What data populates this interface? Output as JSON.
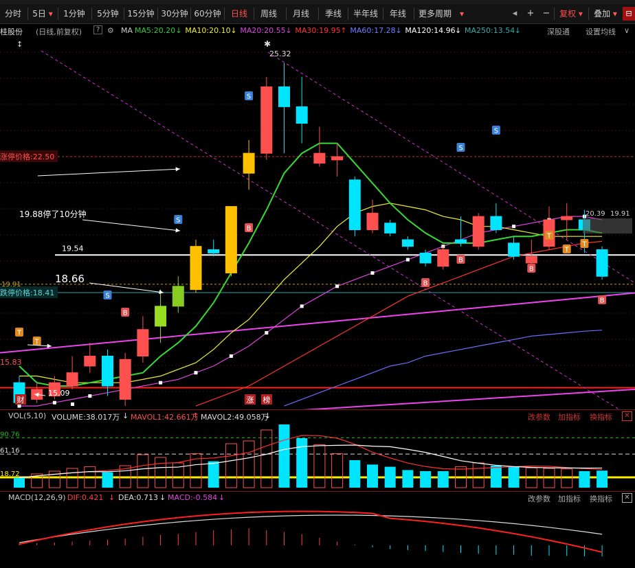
{
  "toolbar": {
    "periods": [
      "分时",
      "5日",
      "1分钟",
      "5分钟",
      "15分钟",
      "30分钟",
      "60分钟",
      "日线",
      "周线",
      "月线",
      "季线",
      "半年线",
      "年线",
      "更多周期"
    ],
    "selected": "日线",
    "right_buttons": {
      "plus": "+",
      "minus": "−",
      "fuquan": "复权",
      "overlay": "叠加"
    },
    "more_arrow": "▾"
  },
  "stock": {
    "name": "桂股份",
    "period_label": "(日线,前复权)",
    "help": "?"
  },
  "ma_legend": {
    "prefix": "MA",
    "items": [
      {
        "label": "MA5:20.20",
        "color": "#33cc33"
      },
      {
        "label": "MA10:20.10",
        "color": "#eeee33"
      },
      {
        "label": "MA20:20.55",
        "color": "#dd44dd"
      },
      {
        "label": "MA30:19.95",
        "color": "#ff3333"
      },
      {
        "label": "MA60:17.28",
        "color": "#7777ff"
      },
      {
        "label": "MA120:14.96",
        "color": "#ffffff"
      },
      {
        "label": "MA250:13.54",
        "color": "#33aaaa"
      }
    ],
    "links": {
      "deep": "深股通",
      "settings": "设置均线"
    }
  },
  "annotations": {
    "peak": "25.32",
    "limit_up": "涨停价格:22.50",
    "limit_down": "跌停价格:18.41",
    "note_stop": "19.88停了10分钟",
    "level_1954": "19.54",
    "level_1866": "18.66",
    "low": "15.09",
    "left_num": "15.83",
    "left_mid": "19.91",
    "right_val": "20.39",
    "right_val2": "19.91",
    "tag_cai": "财",
    "tag_zhang": "涨",
    "tag_bang": "榜",
    "marker_s": "S",
    "marker_b": "B",
    "marker_t": "T"
  },
  "volume_panel": {
    "title": "VOL(5,10)",
    "volume": "VOLUME:38.017万",
    "mavol1": "MAVOL1:42.661万",
    "mavol2": "MAVOL2:49.058万",
    "y_labels": [
      "90.76",
      "61.16",
      "18.72"
    ],
    "links": {
      "params": "改参数",
      "add": "加指标",
      "switch": "换指标"
    }
  },
  "macd_panel": {
    "title": "MACD(12,26,9)",
    "dif": "DIF:0.421",
    "dea": "DEA:0.713",
    "macd": "MACD:-0.584",
    "links": {
      "params": "改参数",
      "add": "加指标",
      "switch": "换指标"
    }
  },
  "chart_data": {
    "type": "candlestick",
    "price_axis_ref": {
      "p1": 22.5,
      "p2": 18.41
    },
    "candles": [
      {
        "o": 15.7,
        "c": 15.1,
        "h": 15.9,
        "l": 15.0
      },
      {
        "o": 15.2,
        "c": 15.5,
        "h": 15.7,
        "l": 15.09
      },
      {
        "o": 15.3,
        "c": 15.7,
        "h": 15.9,
        "l": 15.2
      },
      {
        "o": 15.6,
        "c": 16.0,
        "h": 16.5,
        "l": 15.5
      },
      {
        "o": 16.2,
        "c": 16.5,
        "h": 16.9,
        "l": 16.0
      },
      {
        "o": 16.5,
        "c": 15.6,
        "h": 16.7,
        "l": 15.3
      },
      {
        "o": 15.2,
        "c": 16.4,
        "h": 16.6,
        "l": 15.0
      },
      {
        "o": 16.5,
        "c": 17.3,
        "h": 17.7,
        "l": 16.3
      },
      {
        "o": 17.4,
        "c": 18.0,
        "h": 18.5,
        "l": 16.9
      },
      {
        "o": 18.0,
        "c": 18.6,
        "h": 18.9,
        "l": 17.8
      },
      {
        "o": 18.5,
        "c": 19.8,
        "h": 20.0,
        "l": 18.4
      },
      {
        "o": 19.7,
        "c": 19.6,
        "h": 20.0,
        "l": 19.5
      },
      {
        "o": 19.0,
        "c": 21.0,
        "h": 21.0,
        "l": 18.9
      },
      {
        "o": 22.0,
        "c": 22.6,
        "h": 23.0,
        "l": 21.5
      },
      {
        "o": 22.6,
        "c": 24.6,
        "h": 24.9,
        "l": 22.4
      },
      {
        "o": 24.6,
        "c": 24.0,
        "h": 25.32,
        "l": 22.6
      },
      {
        "o": 24.0,
        "c": 23.5,
        "h": 24.9,
        "l": 22.9
      },
      {
        "o": 22.3,
        "c": 22.6,
        "h": 23.4,
        "l": 22.2
      },
      {
        "o": 22.4,
        "c": 22.5,
        "h": 22.9,
        "l": 21.9
      },
      {
        "o": 21.8,
        "c": 20.3,
        "h": 21.9,
        "l": 20.1
      },
      {
        "o": 20.3,
        "c": 20.8,
        "h": 21.2,
        "l": 20.2
      },
      {
        "o": 20.5,
        "c": 20.2,
        "h": 20.6,
        "l": 20.1
      },
      {
        "o": 20.0,
        "c": 19.8,
        "h": 20.1,
        "l": 19.7
      },
      {
        "o": 19.6,
        "c": 19.3,
        "h": 19.7,
        "l": 19.2
      },
      {
        "o": 19.2,
        "c": 19.7,
        "h": 19.8,
        "l": 19.1
      },
      {
        "o": 20.0,
        "c": 19.9,
        "h": 20.7,
        "l": 19.8
      },
      {
        "o": 19.8,
        "c": 20.7,
        "h": 20.8,
        "l": 19.7
      },
      {
        "o": 20.7,
        "c": 20.3,
        "h": 21.1,
        "l": 20.2
      },
      {
        "o": 19.9,
        "c": 19.5,
        "h": 20.1,
        "l": 19.4
      },
      {
        "o": 19.3,
        "c": 19.5,
        "h": 20.0,
        "l": 19.2
      },
      {
        "o": 19.8,
        "c": 20.6,
        "h": 21.0,
        "l": 19.7
      },
      {
        "o": 20.6,
        "c": 20.7,
        "h": 21.1,
        "l": 20.0
      },
      {
        "o": 20.6,
        "c": 20.3,
        "h": 20.9,
        "l": 19.6
      },
      {
        "o": 19.7,
        "c": 18.9,
        "h": 19.8,
        "l": 18.8
      }
    ],
    "limit_up_days": [
      10,
      12,
      13
    ],
    "ma5": [
      16.2,
      15.7,
      15.6,
      15.6,
      15.7,
      15.8,
      15.9,
      16.0,
      16.5,
      16.9,
      17.4,
      18.1,
      19.0,
      19.9,
      20.9,
      22.0,
      22.6,
      22.9,
      22.9,
      22.3,
      21.7,
      21.1,
      20.6,
      20.2,
      19.9,
      19.9,
      19.9,
      20.0,
      20.1,
      20.1,
      20.2,
      20.3,
      20.3,
      20.2
    ],
    "ma10": [
      15.9,
      15.9,
      15.8,
      15.7,
      15.7,
      15.7,
      15.7,
      15.8,
      15.9,
      16.1,
      16.3,
      16.7,
      17.2,
      17.6,
      18.2,
      18.8,
      19.3,
      19.8,
      20.4,
      20.8,
      21.0,
      21.1,
      21.0,
      20.9,
      20.7,
      20.6,
      20.4,
      20.4,
      20.3,
      20.2,
      20.1,
      20.1,
      20.1,
      20.1
    ],
    "ma20": [
      15.0,
      15.0,
      15.1,
      15.2,
      15.3,
      15.4,
      15.5,
      15.6,
      15.7,
      15.8,
      16.0,
      16.2,
      16.5,
      16.8,
      17.2,
      17.6,
      18.0,
      18.3,
      18.6,
      18.8,
      19.0,
      19.2,
      19.4,
      19.6,
      19.8,
      20.0,
      20.2,
      20.3,
      20.4,
      20.5,
      20.6,
      20.7,
      20.7,
      20.6
    ],
    "ma30": [
      null,
      null,
      null,
      null,
      null,
      null,
      null,
      null,
      null,
      null,
      15.0,
      15.2,
      15.4,
      15.6,
      15.9,
      16.2,
      16.5,
      16.8,
      17.1,
      17.4,
      17.7,
      18.0,
      18.3,
      18.5,
      18.7,
      18.9,
      19.1,
      19.3,
      19.5,
      19.6,
      19.7,
      19.8,
      19.9,
      19.95
    ],
    "ma60": [
      null,
      null,
      null,
      null,
      null,
      null,
      null,
      null,
      null,
      null,
      null,
      null,
      null,
      null,
      null,
      15.0,
      15.2,
      15.4,
      15.6,
      15.8,
      16.0,
      16.2,
      16.3,
      16.5,
      16.6,
      16.7,
      16.8,
      16.9,
      17.0,
      17.1,
      17.15,
      17.2,
      17.25,
      17.28
    ],
    "ma120": [
      14.96,
      14.96
    ],
    "volume": [
      {
        "v": 18,
        "up": false
      },
      {
        "v": 25,
        "up": true
      },
      {
        "v": 30,
        "up": true
      },
      {
        "v": 35,
        "up": true
      },
      {
        "v": 38,
        "up": true
      },
      {
        "v": 28,
        "up": false
      },
      {
        "v": 40,
        "up": true
      },
      {
        "v": 60,
        "up": true
      },
      {
        "v": 55,
        "up": true
      },
      {
        "v": 45,
        "up": true
      },
      {
        "v": 62,
        "up": true
      },
      {
        "v": 48,
        "up": false
      },
      {
        "v": 80,
        "up": true
      },
      {
        "v": 85,
        "up": true
      },
      {
        "v": 105,
        "up": true
      },
      {
        "v": 115,
        "up": false
      },
      {
        "v": 90,
        "up": false
      },
      {
        "v": 78,
        "up": true
      },
      {
        "v": 62,
        "up": true
      },
      {
        "v": 50,
        "up": false
      },
      {
        "v": 42,
        "up": false
      },
      {
        "v": 38,
        "up": false
      },
      {
        "v": 32,
        "up": false
      },
      {
        "v": 30,
        "up": false
      },
      {
        "v": 30,
        "up": false
      },
      {
        "v": 38,
        "up": true
      },
      {
        "v": 45,
        "up": true
      },
      {
        "v": 40,
        "up": false
      },
      {
        "v": 38,
        "up": false
      },
      {
        "v": 36,
        "up": true
      },
      {
        "v": 35,
        "up": true
      },
      {
        "v": 34,
        "up": true
      },
      {
        "v": 30,
        "up": false
      },
      {
        "v": 31,
        "up": false
      }
    ],
    "macd_hist": [
      0.1,
      0.12,
      0.15,
      0.2,
      0.25,
      0.3,
      0.35,
      0.45,
      0.55,
      0.6,
      0.7,
      0.8,
      0.85,
      0.9,
      0.8,
      0.7,
      0.6,
      0.4,
      0.2,
      0.05,
      -0.1,
      -0.2,
      -0.25,
      -0.3,
      -0.35,
      -0.4,
      -0.45,
      -0.5,
      -0.5,
      -0.55,
      -0.55,
      -0.56,
      -0.58,
      -0.584
    ]
  }
}
